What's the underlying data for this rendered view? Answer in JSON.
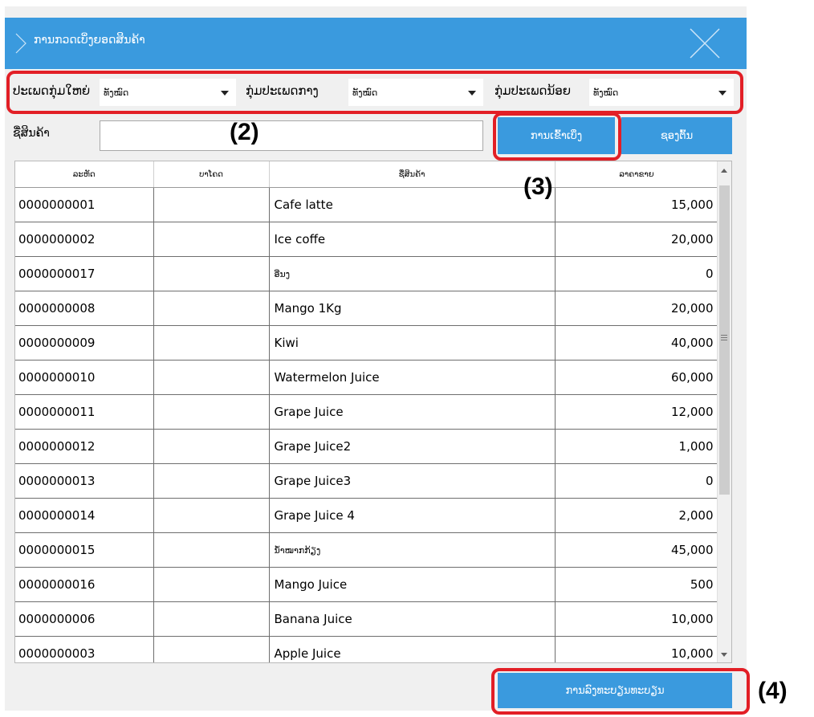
{
  "window": {
    "title": "ການກວດເບິ່ງຍອດສິນຄ້າ"
  },
  "filters": [
    {
      "label": "ປະເພດກຸ່ມໃຫຍ່",
      "value": "ທັງໝົດ"
    },
    {
      "label": "ກຸ່ມປະເພດກາງ",
      "value": "ທັງໝົດ"
    },
    {
      "label": "ກຸ່ມປະເພດນ້ອຍ",
      "value": "ທັງໝົດ"
    }
  ],
  "search": {
    "label": "ຊື່ສິນຄ້າ",
    "value": "",
    "search_button": "ການເຂົ້າເບິ່ງ",
    "reset_button": "ຊອງຕົ້ນ"
  },
  "table": {
    "columns": [
      "ລະຫັດ",
      "ບາໂຄດ",
      "ຊື່ສິນຄ້າ",
      "ລາຄາຂາຍ"
    ],
    "rows": [
      [
        "0000000001",
        "",
        "Cafe latte",
        "15,000"
      ],
      [
        "0000000002",
        "",
        "Ice coffe",
        "20,000"
      ],
      [
        "0000000017",
        "",
        "ອີ່ນງ",
        "0"
      ],
      [
        "0000000008",
        "",
        "Mango 1Kg",
        "20,000"
      ],
      [
        "0000000009",
        "",
        "Kiwi",
        "40,000"
      ],
      [
        "0000000010",
        "",
        "Watermelon Juice",
        "60,000"
      ],
      [
        "0000000011",
        "",
        "Grape Juice",
        "12,000"
      ],
      [
        "0000000012",
        "",
        "Grape Juice2",
        "1,000"
      ],
      [
        "0000000013",
        "",
        "Grape Juice3",
        "0"
      ],
      [
        "0000000014",
        "",
        "Grape Juice 4",
        "2,000"
      ],
      [
        "0000000015",
        "",
        "ນ້ຳໝາກກ້ຽງ",
        "45,000"
      ],
      [
        "0000000016",
        "",
        "Mango Juice",
        "500"
      ],
      [
        "0000000006",
        "",
        "Banana Juice",
        "10,000"
      ],
      [
        "0000000003",
        "",
        "Apple Juice",
        "10,000"
      ]
    ]
  },
  "register_button": "ການລົງທະບຽນທະບຽນ",
  "annotations": [
    "(2)",
    "(3)",
    "(4)"
  ],
  "colors": {
    "accent": "#3a9ade",
    "annotation_frame": "#e21f26"
  },
  "icons": [
    "chevron-right-icon",
    "close-icon",
    "dropdown-caret-icon",
    "scroll-up-icon",
    "scroll-down-icon"
  ]
}
